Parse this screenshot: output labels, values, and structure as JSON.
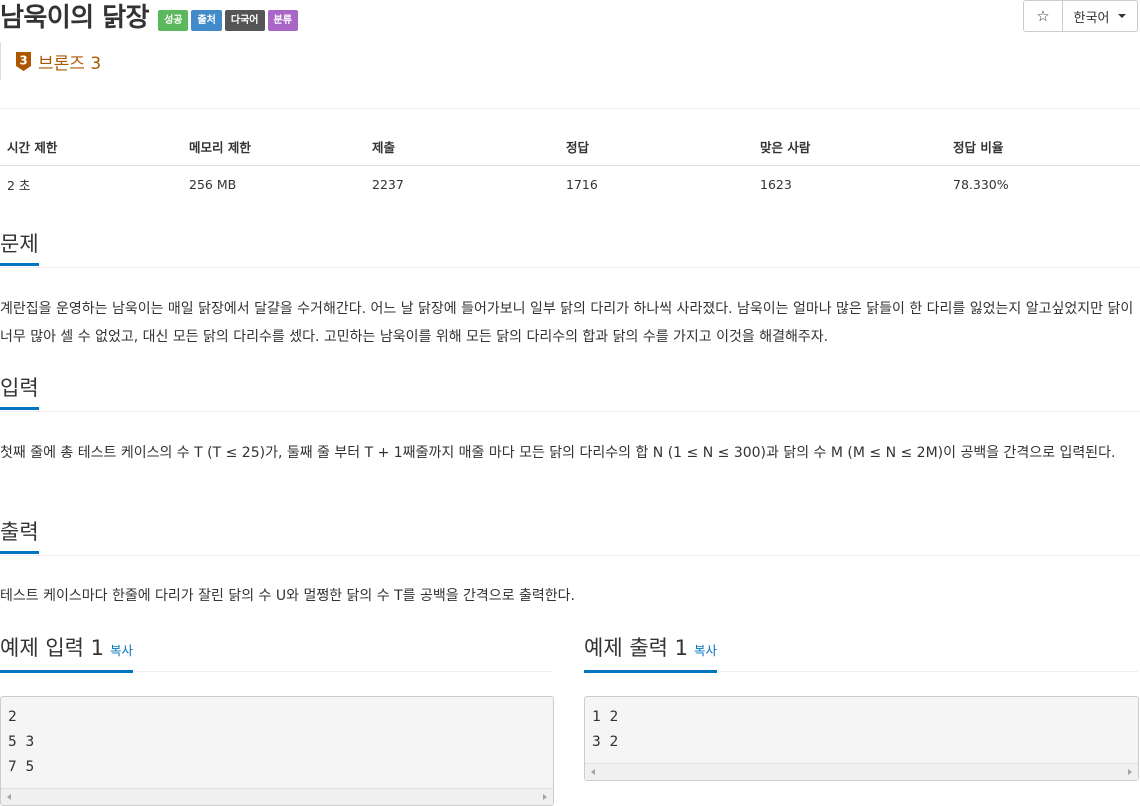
{
  "problem": {
    "title": "남욱이의 닭장",
    "labels": [
      {
        "text": "성공",
        "color": "#5cb85c"
      },
      {
        "text": "출처",
        "color": "#428bca"
      },
      {
        "text": "다국어",
        "color": "#555555"
      },
      {
        "text": "분류",
        "color": "#a866c6"
      }
    ],
    "tier": {
      "number": "3",
      "name": "브론즈 3",
      "color": "#ad5600"
    }
  },
  "toolbar": {
    "star_icon": "☆",
    "language": "한국어"
  },
  "info_table": {
    "headers": [
      "시간 제한",
      "메모리 제한",
      "제출",
      "정답",
      "맞은 사람",
      "정답 비율"
    ],
    "values": [
      "2 초",
      "256 MB",
      "2237",
      "1716",
      "1623",
      "78.330%"
    ]
  },
  "sections": {
    "problem": {
      "title": "문제",
      "text": "계란집을 운영하는 남욱이는 매일 닭장에서 달걀을 수거해간다. 어느 날 닭장에 들어가보니 일부 닭의 다리가 하나씩 사라졌다. 남욱이는 얼마나 많은 닭들이 한 다리를 잃었는지 알고싶었지만 닭이 너무 많아 셀 수 없었고, 대신 모든 닭의 다리수를 셌다. 고민하는 남욱이를 위해 모든 닭의 다리수의 합과 닭의 수를 가지고 이것을 해결해주자."
    },
    "input": {
      "title": "입력",
      "text": "첫째 줄에 총 테스트 케이스의 수 T (T ≤ 25)가, 둘째 줄 부터 T + 1째줄까지 매줄 마다 모든 닭의 다리수의 합 N (1 ≤ N ≤ 300)과 닭의 수 M (M ≤ N ≤ 2M)이 공백을 간격으로 입력된다."
    },
    "output": {
      "title": "출력",
      "text": "테스트 케이스마다 한줄에 다리가 잘린 닭의 수 U와 멀쩡한 닭의 수 T를 공백을 간격으로 출력한다."
    }
  },
  "samples": {
    "input": {
      "title": "예제 입력 1",
      "copy": "복사",
      "lines": [
        "2",
        "5 3",
        "7 5"
      ]
    },
    "output": {
      "title": "예제 출력 1",
      "copy": "복사",
      "lines": [
        "1 2",
        "3 2"
      ]
    }
  }
}
